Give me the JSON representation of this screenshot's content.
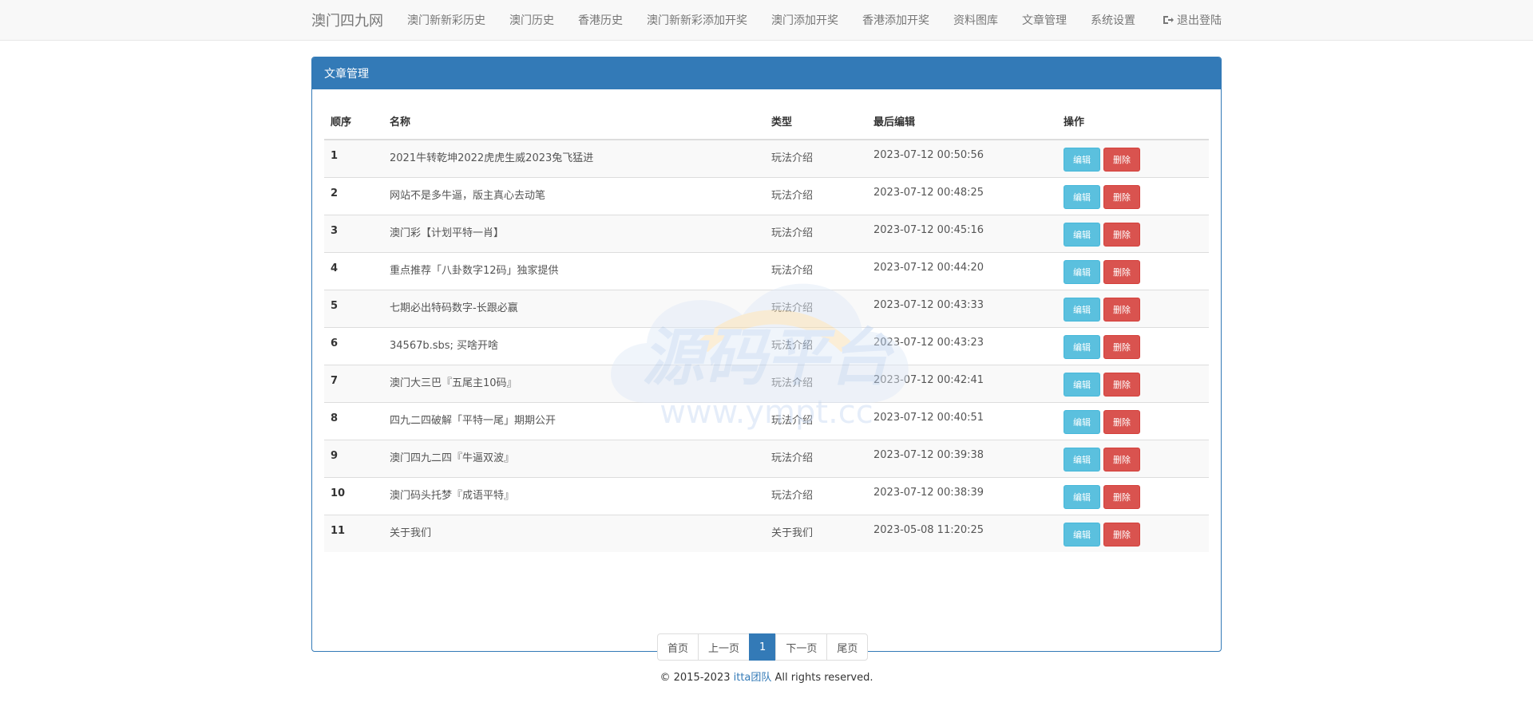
{
  "navbar": {
    "brand": "澳门四九网",
    "items": [
      {
        "label": "澳门新新彩历史"
      },
      {
        "label": "澳门历史"
      },
      {
        "label": "香港历史"
      },
      {
        "label": "澳门新新彩添加开奖"
      },
      {
        "label": "澳门添加开奖"
      },
      {
        "label": "香港添加开奖"
      },
      {
        "label": "资料图库"
      },
      {
        "label": "文章管理"
      },
      {
        "label": "系统设置"
      }
    ],
    "logout_label": "退出登陆",
    "logout_icon": "sign-out-icon"
  },
  "panel": {
    "title": "文章管理"
  },
  "table": {
    "columns": [
      "顺序",
      "名称",
      "类型",
      "最后编辑",
      "操作"
    ],
    "edit_label": "编辑",
    "delete_label": "删除",
    "rows": [
      {
        "index": "1",
        "name": "2021牛转乾坤2022虎虎生威2023兔飞猛进",
        "type": "玩法介绍",
        "edited": "2023-07-12 00:50:56"
      },
      {
        "index": "2",
        "name": "网站不是多牛逼，版主真心去动笔",
        "type": "玩法介绍",
        "edited": "2023-07-12 00:48:25"
      },
      {
        "index": "3",
        "name": "澳门彩【计划平特一肖】",
        "type": "玩法介绍",
        "edited": "2023-07-12 00:45:16"
      },
      {
        "index": "4",
        "name": "重点推荐「八卦数字12码」独家提供",
        "type": "玩法介绍",
        "edited": "2023-07-12 00:44:20"
      },
      {
        "index": "5",
        "name": "七期必出特码数字-长跟必赢",
        "type": "玩法介绍",
        "edited": "2023-07-12 00:43:33"
      },
      {
        "index": "6",
        "name": "34567b.sbs; 买啥开啥",
        "type": "玩法介绍",
        "edited": "2023-07-12 00:43:23"
      },
      {
        "index": "7",
        "name": "澳门大三巴『五尾主10码』",
        "type": "玩法介绍",
        "edited": "2023-07-12 00:42:41"
      },
      {
        "index": "8",
        "name": "四九二四破解「平特一尾」期期公开",
        "type": "玩法介绍",
        "edited": "2023-07-12 00:40:51"
      },
      {
        "index": "9",
        "name": "澳门四九二四『牛逼双波』",
        "type": "玩法介绍",
        "edited": "2023-07-12 00:39:38"
      },
      {
        "index": "10",
        "name": "澳门码头托梦『成语平特』",
        "type": "玩法介绍",
        "edited": "2023-07-12 00:38:39"
      },
      {
        "index": "11",
        "name": "关于我们",
        "type": "关于我们",
        "edited": "2023-05-08 11:20:25"
      }
    ]
  },
  "pagination": {
    "first": "首页",
    "prev": "上一页",
    "current": "1",
    "next": "下一页",
    "last": "尾页"
  },
  "footer": {
    "prefix": "© 2015-2023 ",
    "link": "itta团队",
    "suffix": " All rights reserved."
  },
  "watermark": {
    "title": "源码平台",
    "url": "www.ympt.cc"
  },
  "colors": {
    "primary": "#337ab7",
    "edit": "#5bc0de",
    "delete": "#d9534f"
  }
}
